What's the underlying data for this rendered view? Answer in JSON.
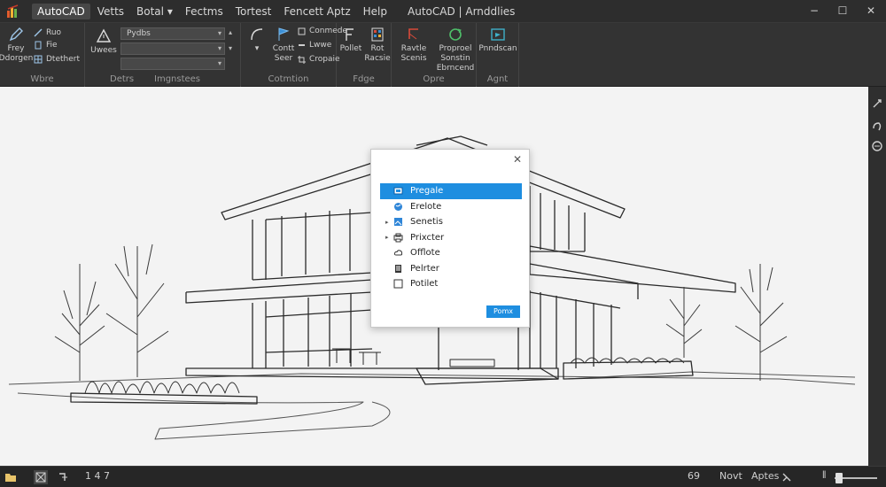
{
  "window": {
    "title": "AutoCAD | Arnddlies",
    "controls": [
      "−",
      "☐",
      "✕"
    ]
  },
  "menu": {
    "items": [
      "AutoCAD",
      "Vetts",
      "Botal ▾",
      "Fectms",
      "Tortest",
      "Fencett Aptz",
      "Help"
    ],
    "active_index": 0
  },
  "ribbon": {
    "draw": {
      "label": "Wbre",
      "buttons": [
        "Frey Ddorgen",
        "Ruo",
        "Fie",
        "Dtethert"
      ]
    },
    "data": {
      "label": "Detrs",
      "sub_label": "Imgnstees",
      "left_button": "Uwees",
      "combo1_value": "Pydbs",
      "combo2_value": "",
      "combo3_value": ""
    },
    "annotation": {
      "label": "Cotmtion",
      "buttons": [
        "Contt Seer",
        "Conmede",
        "Lwwe",
        "Cropaie"
      ]
    },
    "page": {
      "label": "Fdge",
      "buttons": [
        "Pollet",
        "Rot Racsie"
      ]
    },
    "open": {
      "label": "Opre",
      "buttons": [
        "Ravtle Scenis",
        "Proproel Sonstin Ebrncend"
      ]
    },
    "apply": {
      "label": "Agnt",
      "buttons": [
        "Pnndscan"
      ]
    }
  },
  "dialog": {
    "close_glyph": "✕",
    "items": [
      {
        "label": "Pregale",
        "icon": "folder-icon",
        "arrow": "",
        "selected": true
      },
      {
        "label": "Erelote",
        "icon": "globe-icon",
        "arrow": "",
        "selected": false
      },
      {
        "label": "Senetis",
        "icon": "image-icon",
        "arrow": "▸",
        "selected": false
      },
      {
        "label": "Prixcter",
        "icon": "printer-icon",
        "arrow": "▸",
        "selected": false
      },
      {
        "label": "Offlote",
        "icon": "cloud-icon",
        "arrow": "",
        "selected": false
      },
      {
        "label": "Pelrter",
        "icon": "document-icon",
        "arrow": "",
        "selected": false
      },
      {
        "label": "Potilet",
        "icon": "checkbox-icon",
        "arrow": "",
        "selected": false
      }
    ],
    "ok_label": "Pomx"
  },
  "statusbar": {
    "coordinates": "1 4 7",
    "number": "69",
    "next_label": "Novt",
    "aptes_label": "Aptes",
    "zoom_value": 0.1
  },
  "colors": {
    "accent": "#1e8ee0",
    "ribbon_bg": "#333333",
    "canvas_bg": "#f3f3f3"
  }
}
